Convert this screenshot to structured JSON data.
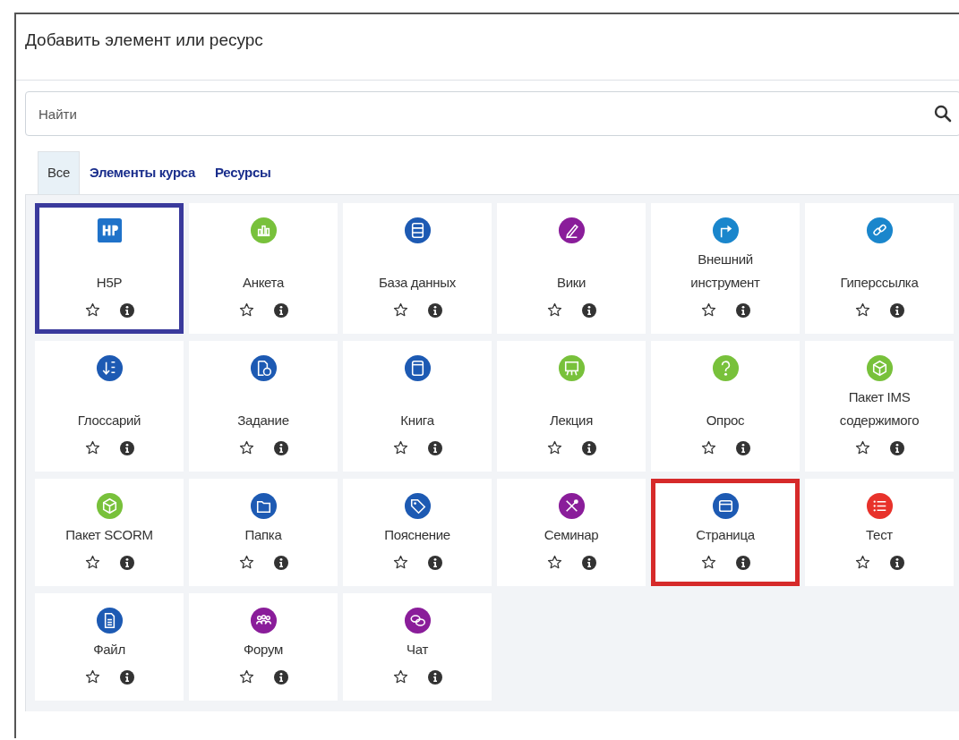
{
  "dialog": {
    "title": "Добавить элемент или ресурс"
  },
  "search": {
    "placeholder": "Найти"
  },
  "tabs": [
    {
      "label": "Все",
      "selected": true
    },
    {
      "label": "Элементы курса",
      "selected": false
    },
    {
      "label": "Ресурсы",
      "selected": false
    }
  ],
  "items": [
    {
      "name": "H5P",
      "kind": "h5p",
      "color": "#1f72c9",
      "frame": {
        "color": "#3a3a9c"
      }
    },
    {
      "name": "Анкета",
      "kind": "chart",
      "color": "#78c13b"
    },
    {
      "name": "База данных",
      "kind": "database",
      "color": "#1d5ab3"
    },
    {
      "name": "Вики",
      "kind": "pencil",
      "color": "#8a1d9a"
    },
    {
      "name": "Внешний инструмент",
      "kind": "arrow",
      "color": "#1a86cc"
    },
    {
      "name": "Гиперссылка",
      "kind": "link",
      "color": "#1a86cc"
    },
    {
      "name": "Глоссарий",
      "kind": "sort",
      "color": "#1d5ab3"
    },
    {
      "name": "Задание",
      "kind": "document",
      "color": "#1d5ab3"
    },
    {
      "name": "Книга",
      "kind": "book",
      "color": "#1d5ab3"
    },
    {
      "name": "Лекция",
      "kind": "easel",
      "color": "#78c13b"
    },
    {
      "name": "Опрос",
      "kind": "question",
      "color": "#78c13b"
    },
    {
      "name": "Пакет IMS содержимого",
      "kind": "cube",
      "color": "#78c13b"
    },
    {
      "name": "Пакет SCORM",
      "kind": "cube",
      "color": "#78c13b"
    },
    {
      "name": "Папка",
      "kind": "folder",
      "color": "#1d5ab3"
    },
    {
      "name": "Пояснение",
      "kind": "tag",
      "color": "#1d5ab3"
    },
    {
      "name": "Семинар",
      "kind": "tools",
      "color": "#8a1d9a"
    },
    {
      "name": "Страница",
      "kind": "window",
      "color": "#1d5ab3",
      "frame": {
        "color": "#d62a2a"
      }
    },
    {
      "name": "Тест",
      "kind": "list",
      "color": "#e8322b"
    },
    {
      "name": "Файл",
      "kind": "file",
      "color": "#1d5ab3"
    },
    {
      "name": "Форум",
      "kind": "people",
      "color": "#8a1d9a"
    },
    {
      "name": "Чат",
      "kind": "chat",
      "color": "#8a1d9a"
    }
  ]
}
